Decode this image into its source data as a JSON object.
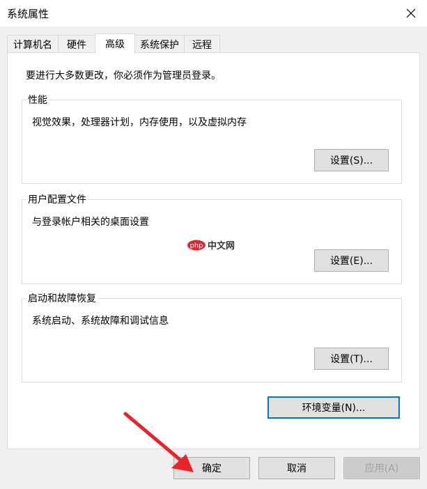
{
  "window": {
    "title": "系统属性"
  },
  "tabs": [
    {
      "label": "计算机名",
      "active": false
    },
    {
      "label": "硬件",
      "active": false
    },
    {
      "label": "高级",
      "active": true
    },
    {
      "label": "系统保护",
      "active": false
    },
    {
      "label": "远程",
      "active": false
    }
  ],
  "advanced": {
    "admin_notice": "要进行大多数更改，你必须作为管理员登录。",
    "groups": [
      {
        "title": "性能",
        "description": "视觉效果，处理器计划，内存使用，以及虚拟内存",
        "button": "设置(S)..."
      },
      {
        "title": "用户配置文件",
        "description": "与登录帐户相关的桌面设置",
        "button": "设置(E)..."
      },
      {
        "title": "启动和故障恢复",
        "description": "系统启动、系统故障和调试信息",
        "button": "设置(T)..."
      }
    ],
    "env_button": "环境变量(N)..."
  },
  "footer": {
    "ok": "确定",
    "cancel": "取消",
    "apply": "应用(A)"
  },
  "watermark": {
    "badge": "php",
    "text": "中文网"
  },
  "colors": {
    "focus_border": "#0078d7",
    "arrow": "#e8232c",
    "watermark_badge": "#e8232c"
  }
}
